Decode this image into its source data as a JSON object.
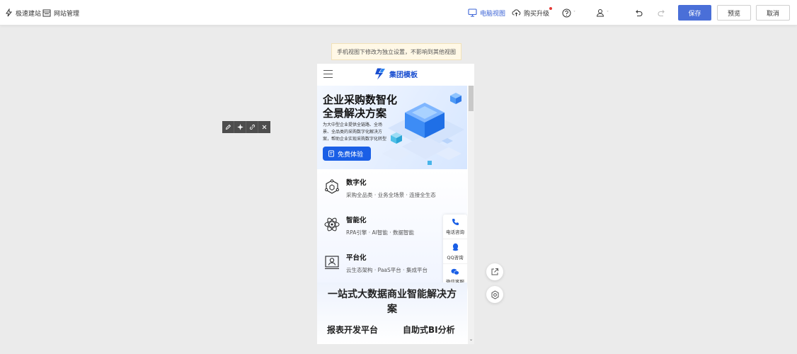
{
  "toolbar": {
    "quick_build_label": "极速建站",
    "site_manage_label": "网站管理",
    "desktop_view_label": "电脑视图",
    "buy_upgrade_label": "购买升级",
    "help_caret": "˅",
    "account_caret": "˅",
    "save_label": "保存",
    "preview_label": "预览",
    "cancel_label": "取消",
    "accent_color": "#3b63d6"
  },
  "notice": {
    "text": "手机视图下修改为独立设置，不影响到其他视图"
  },
  "mobile": {
    "header": {
      "logo_text": "集团模板"
    },
    "banner": {
      "title_line1": "企业采购数智化",
      "title_line2": "全景解决方案",
      "desc_line1": "为大中型企业提供全链路、全场",
      "desc_line2": "景、全品类的采购数字化解决方",
      "desc_line3": "案，帮助企业实现采购数字化转型",
      "button_label": "免费体验"
    },
    "features": [
      {
        "title": "数字化",
        "desc": "采购全品类 · 业务全场景 · 连接全生态",
        "icon": "blockchain-icon"
      },
      {
        "title": "智能化",
        "desc": "RPA引擎 · AI智能 · 数据智能",
        "icon": "atom-icon"
      },
      {
        "title": "平台化",
        "desc": "云生态架构 · PaaS平台 · 集成平台",
        "icon": "profile-card-icon"
      }
    ],
    "side_float": [
      {
        "label": "电话咨询",
        "icon": "phone-icon"
      },
      {
        "label": "QQ咨询",
        "icon": "qq-icon"
      },
      {
        "label": "微信客服",
        "icon": "wechat-icon"
      }
    ],
    "section2": {
      "title_line1": "一站式大数据商业智能解决方",
      "title_line2": "案",
      "tab_left": "报表开发平台",
      "tab_right": "自助式BI分析"
    },
    "scroll_arrow": "⌄"
  }
}
